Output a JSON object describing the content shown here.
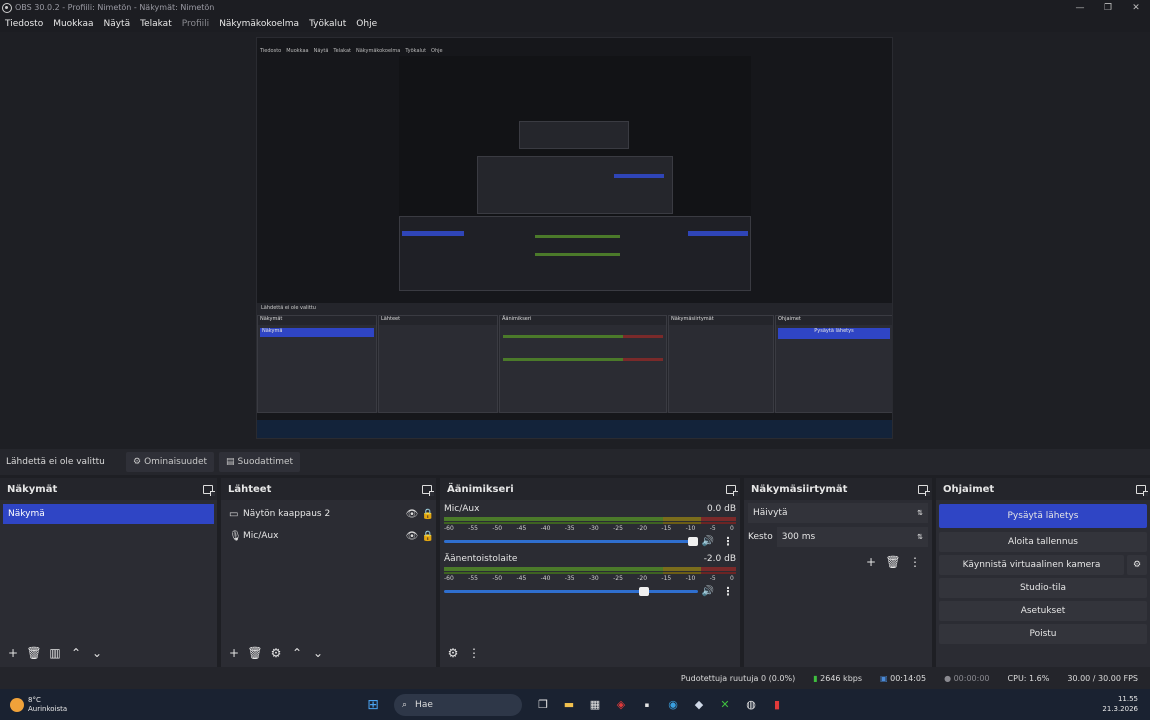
{
  "window": {
    "title": "OBS 30.0.2 - Profiili: Nimetön - Näkymät: Nimetön",
    "minimize": "—",
    "maximize": "❐",
    "close": "✕"
  },
  "menu": [
    {
      "label": "Tiedosto",
      "dim": false
    },
    {
      "label": "Muokkaa",
      "dim": false
    },
    {
      "label": "Näytä",
      "dim": false
    },
    {
      "label": "Telakat",
      "dim": false
    },
    {
      "label": "Profiili",
      "dim": true
    },
    {
      "label": "Näkymäkokoelma",
      "dim": false
    },
    {
      "label": "Työkalut",
      "dim": false
    },
    {
      "label": "Ohje",
      "dim": false
    }
  ],
  "source_bar": {
    "no_source": "Lähdettä ei ole valittu",
    "properties": "Ominaisuudet",
    "filters": "Suodattimet"
  },
  "scenes": {
    "title": "Näkymät",
    "items": [
      "Näkymä"
    ]
  },
  "sources": {
    "title": "Lähteet",
    "items": [
      {
        "icon": "display-capture-icon",
        "label": "Näytön kaappaus 2"
      },
      {
        "icon": "microphone-icon",
        "label": "Mic/Aux"
      }
    ]
  },
  "mixer": {
    "title": "Äänimikseri",
    "ticks": [
      "-60",
      "-55",
      "-50",
      "-45",
      "-40",
      "-35",
      "-30",
      "-25",
      "-20",
      "-15",
      "-10",
      "-5",
      "0"
    ],
    "channels": [
      {
        "name": "Mic/Aux",
        "db": "0.0 dB",
        "volume": 1.0
      },
      {
        "name": "Äänentoistolaite",
        "db": "-2.0 dB",
        "volume": 0.8
      }
    ]
  },
  "transitions": {
    "title": "Näkymäsiirtymät",
    "selected": "Häivytä",
    "duration_label": "Kesto",
    "duration_value": "300 ms"
  },
  "controls": {
    "title": "Ohjaimet",
    "stop_stream": "Pysäytä lähetys",
    "start_recording": "Aloita tallennus",
    "start_virtualcam": "Käynnistä virtuaalinen kamera",
    "studio_mode": "Studio-tila",
    "settings": "Asetukset",
    "exit": "Poistu"
  },
  "status": {
    "dropped": "Pudotettuja ruutuja 0 (0.0%)",
    "bitrate": "2646 kbps",
    "stream_time": "00:14:05",
    "rec_time": "00:00:00",
    "cpu": "CPU: 1.6%",
    "fps": "30.00 / 30.00 FPS"
  },
  "preview_nested": {
    "no_source": "Lähdettä ei ole valittu",
    "scenes": "Näkymät",
    "sources": "Lähteet",
    "mixer": "Äänimikseri",
    "transitions": "Näkymäsiirtymät",
    "controls": "Ohjaimet",
    "scene": "Näkymä",
    "stop_stream": "Pysäytä lähetys"
  },
  "taskbar": {
    "temp": "8°C",
    "weather": "Aurinkoista",
    "search": "Hae",
    "time": "11.55",
    "date": "21.3.2026"
  },
  "colors": {
    "accent": "#2f45c5",
    "panel": "#2b2c33",
    "background": "#1e1f24"
  }
}
